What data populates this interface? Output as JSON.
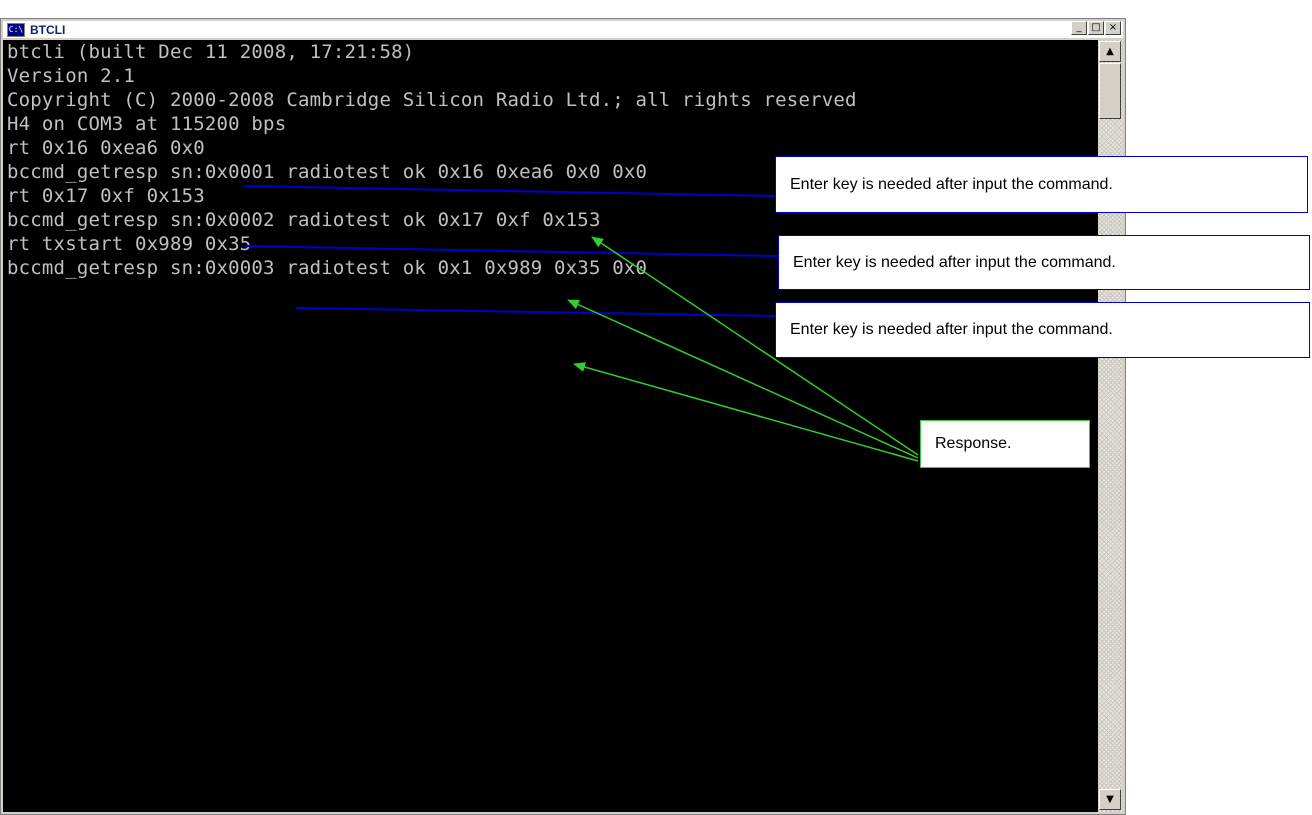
{
  "window": {
    "title": "BTCLI",
    "icon": "C:\\",
    "controls": {
      "minimize": "_",
      "maximize": "□",
      "close": "×"
    }
  },
  "console": {
    "lines": [
      "btcli (built Dec 11 2008, 17:21:58)",
      "Version 2.1",
      "Copyright (C) 2000-2008 Cambridge Silicon Radio Ltd.; all rights reserved",
      "H4 on COM3 at 115200 bps",
      "rt 0x16 0xea6 0x0",
      "bccmd_getresp sn:0x0001 radiotest ok 0x16 0xea6 0x0 0x0",
      "rt 0x17 0xf 0x153",
      "bccmd_getresp sn:0x0002 radiotest ok 0x17 0xf 0x153",
      "rt txstart 0x989 0x35",
      "bccmd_getresp sn:0x0003 radiotest ok 0x1 0x989 0x35 0x0"
    ]
  },
  "scrollbar": {
    "up": "▲",
    "down": "▼"
  },
  "annotations": {
    "enter_note_1": "Enter key is needed after input the command.",
    "enter_note_2": "Enter key is needed after input the command.",
    "enter_note_3": "Enter key is needed after input the command.",
    "response_note": "Response."
  },
  "colors": {
    "console_bg": "#000000",
    "console_text": "#c0c0c0",
    "command_arrow": "#0000cc",
    "response_arrow": "#33cc33"
  }
}
